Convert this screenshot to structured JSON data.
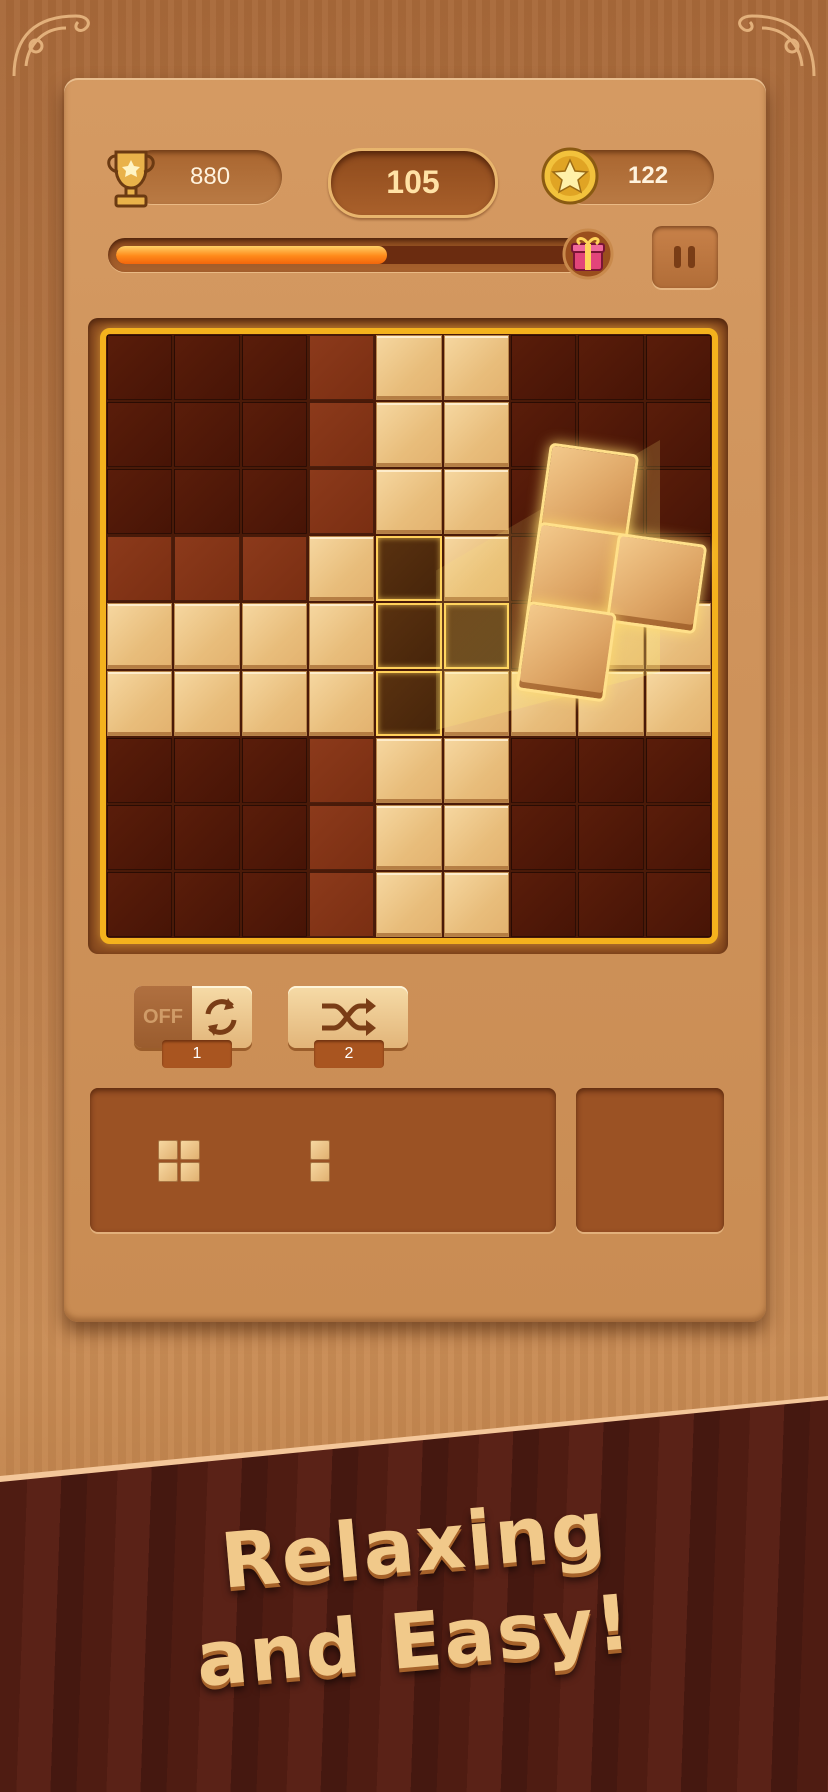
{
  "header": {
    "best_score": "880",
    "current_score": "105",
    "coins": "122",
    "progress_fraction": 0.56
  },
  "icons": {
    "best": "trophy-icon",
    "coins": "star-coin-icon",
    "progress_reward": "gift-icon",
    "pause": "pause-icon",
    "rotate": "rotate-icon",
    "shuffle": "shuffle-icon"
  },
  "tools": {
    "rotate_state": "OFF",
    "rotate_count": "1",
    "shuffle_count": "2"
  },
  "board": {
    "size": 9,
    "filled_cells": [
      [
        0,
        4
      ],
      [
        0,
        5
      ],
      [
        1,
        4
      ],
      [
        1,
        5
      ],
      [
        2,
        4
      ],
      [
        2,
        5
      ],
      [
        3,
        3
      ],
      [
        3,
        5
      ],
      [
        4,
        0
      ],
      [
        4,
        1
      ],
      [
        4,
        2
      ],
      [
        4,
        3
      ],
      [
        4,
        7
      ],
      [
        4,
        8
      ],
      [
        5,
        0
      ],
      [
        5,
        1
      ],
      [
        5,
        2
      ],
      [
        5,
        3
      ],
      [
        5,
        5
      ],
      [
        5,
        6
      ],
      [
        5,
        7
      ],
      [
        5,
        8
      ],
      [
        6,
        4
      ],
      [
        6,
        5
      ],
      [
        7,
        4
      ],
      [
        7,
        5
      ],
      [
        8,
        4
      ],
      [
        8,
        5
      ]
    ],
    "highlight_cells": [
      [
        3,
        4
      ],
      [
        4,
        4
      ],
      [
        4,
        5
      ],
      [
        5,
        4
      ]
    ],
    "light_regions": [
      [
        0,
        3
      ],
      [
        1,
        3
      ],
      [
        2,
        3
      ],
      [
        3,
        0
      ],
      [
        3,
        1
      ],
      [
        3,
        2
      ],
      [
        6,
        3
      ],
      [
        7,
        3
      ],
      [
        8,
        3
      ]
    ]
  },
  "banner": {
    "line1": "Relaxing",
    "line2": "and Easy!"
  },
  "colors": {
    "accent": "#f4b21d",
    "progress": "#ff8a1a",
    "block": "#e8bd7b"
  }
}
